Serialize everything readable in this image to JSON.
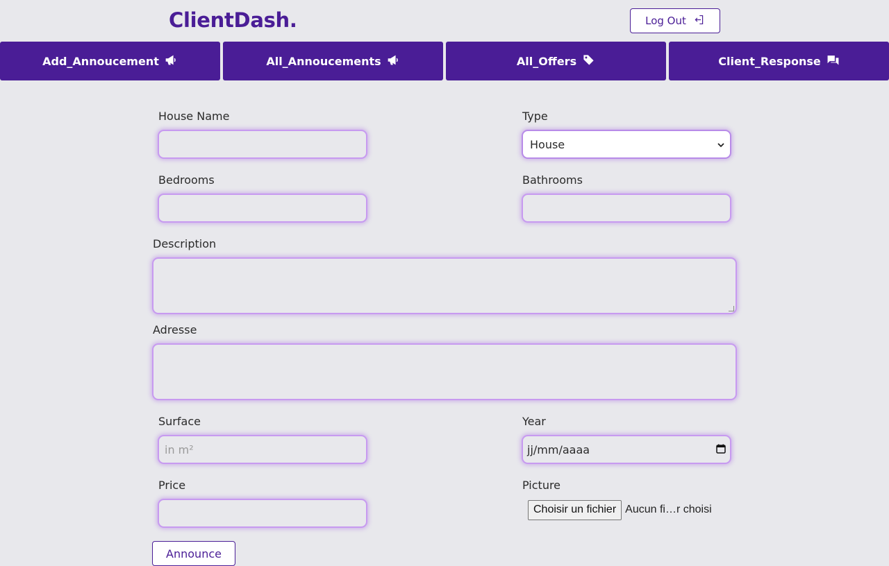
{
  "app": {
    "brand": "ClientDash."
  },
  "header": {
    "logout_label": "Log Out",
    "logout_icon": "logout-icon"
  },
  "nav": {
    "items": [
      {
        "label": "Add_Annoucement",
        "icon": "megaphone-icon"
      },
      {
        "label": "All_Annoucements",
        "icon": "megaphone-icon"
      },
      {
        "label": "All_Offers",
        "icon": "tag-icon"
      },
      {
        "label": "Client_Response",
        "icon": "chat-icon"
      }
    ]
  },
  "form": {
    "house_name": {
      "label": "House Name",
      "value": ""
    },
    "type": {
      "label": "Type",
      "value": "House"
    },
    "bedrooms": {
      "label": "Bedrooms",
      "value": ""
    },
    "bathrooms": {
      "label": "Bathrooms",
      "value": ""
    },
    "description": {
      "label": "Description",
      "value": ""
    },
    "adresse": {
      "label": "Adresse",
      "value": ""
    },
    "surface": {
      "label": "Surface",
      "placeholder": "in m²"
    },
    "year": {
      "label": "Year",
      "placeholder": "jj/mm/aaaa"
    },
    "price": {
      "label": "Price",
      "value": ""
    },
    "picture": {
      "label": "Picture",
      "button_label": "Choisir un fichier",
      "status": "Aucun fi…r choisi"
    },
    "submit_label": "Announce"
  },
  "colors": {
    "accent": "#4a1d96",
    "field_glow": "#c79af0",
    "background": "#e8e8ec"
  }
}
